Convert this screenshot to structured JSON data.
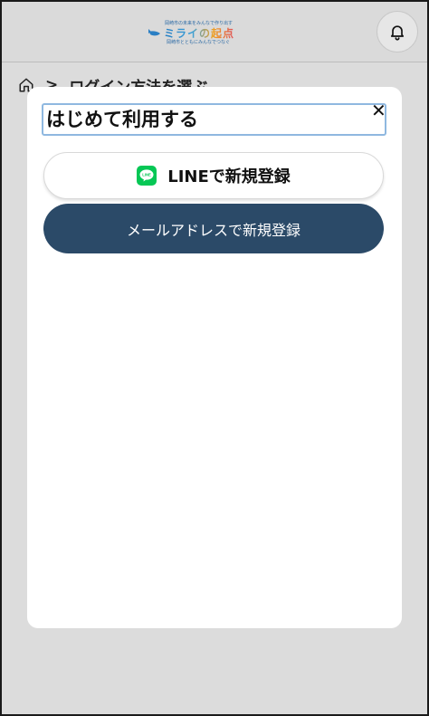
{
  "header": {
    "logo": {
      "tagline": "岡崎市の未来をみんなで作り出す",
      "name": "ミライの起点",
      "subline": "岡崎市とともにみんなでつなぐ"
    },
    "notification_icon": "bell-icon"
  },
  "breadcrumb": {
    "home_icon": "home-icon",
    "separator": ">",
    "current": "ログイン方法を選ぶ"
  },
  "modal": {
    "title": "はじめて利用する",
    "close_label": "✕",
    "line_button": {
      "icon": "line-icon",
      "icon_text": "LINE",
      "label": "LINEで新規登録"
    },
    "mail_button": {
      "label": "メールアドレスで新規登録"
    }
  },
  "colors": {
    "line_green": "#06c755",
    "primary_navy": "#2b4a68",
    "focus_outline": "#8fb8e0",
    "overlay": "#dcdcdc"
  }
}
